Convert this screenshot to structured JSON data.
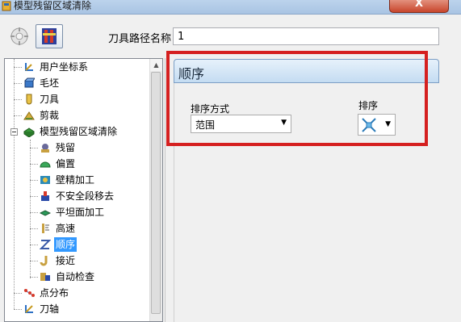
{
  "window": {
    "title": "模型残留区域清除",
    "close_label": "X"
  },
  "toolbar": {
    "path_name_label": "刀具路径名称",
    "path_name_value": "1"
  },
  "tree": {
    "items": [
      {
        "label": "用户坐标系",
        "icon": "ucs-icon"
      },
      {
        "label": "毛坯",
        "icon": "block-icon"
      },
      {
        "label": "刀具",
        "icon": "tool-icon"
      },
      {
        "label": "剪裁",
        "icon": "trim-icon"
      },
      {
        "label": "模型残留区域清除",
        "icon": "rest-machining-icon"
      },
      {
        "label": "残留",
        "icon": "rest-icon"
      },
      {
        "label": "偏置",
        "icon": "offset-icon"
      },
      {
        "label": "壁精加工",
        "icon": "wall-finish-icon"
      },
      {
        "label": "不安全段移去",
        "icon": "unsafe-segment-icon"
      },
      {
        "label": "平坦面加工",
        "icon": "flat-machining-icon"
      },
      {
        "label": "高速",
        "icon": "high-speed-icon"
      },
      {
        "label": "顺序",
        "icon": "order-icon"
      },
      {
        "label": "接近",
        "icon": "approach-icon"
      },
      {
        "label": "自动检查",
        "icon": "auto-check-icon"
      },
      {
        "label": "点分布",
        "icon": "point-distribution-icon"
      },
      {
        "label": "刀轴",
        "icon": "tool-axis-icon"
      }
    ],
    "selected": "顺序"
  },
  "order_section": {
    "header": "顺序",
    "sort_method_label": "排序方式",
    "sort_method_value": "范围",
    "sort_label": "排序"
  },
  "colors": {
    "highlight_box": "#d52020",
    "selection": "#3399ff",
    "header_border": "#7c9ec4"
  }
}
